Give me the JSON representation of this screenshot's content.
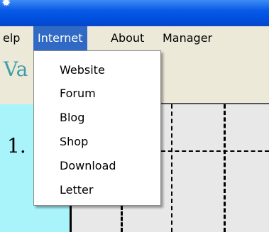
{
  "window": {
    "title_glyph": "✹"
  },
  "menubar": {
    "items": [
      {
        "label": "elp"
      },
      {
        "label": "Internet"
      },
      {
        "label": "About"
      },
      {
        "label": "Manager"
      }
    ]
  },
  "dropdown": {
    "items": [
      {
        "label": "Website"
      },
      {
        "label": "Forum"
      },
      {
        "label": "Blog"
      },
      {
        "label": "Shop"
      },
      {
        "label": "Download"
      },
      {
        "label": "Letter"
      }
    ]
  },
  "content": {
    "heading_partial": "Va",
    "row_number_partial": "1."
  }
}
